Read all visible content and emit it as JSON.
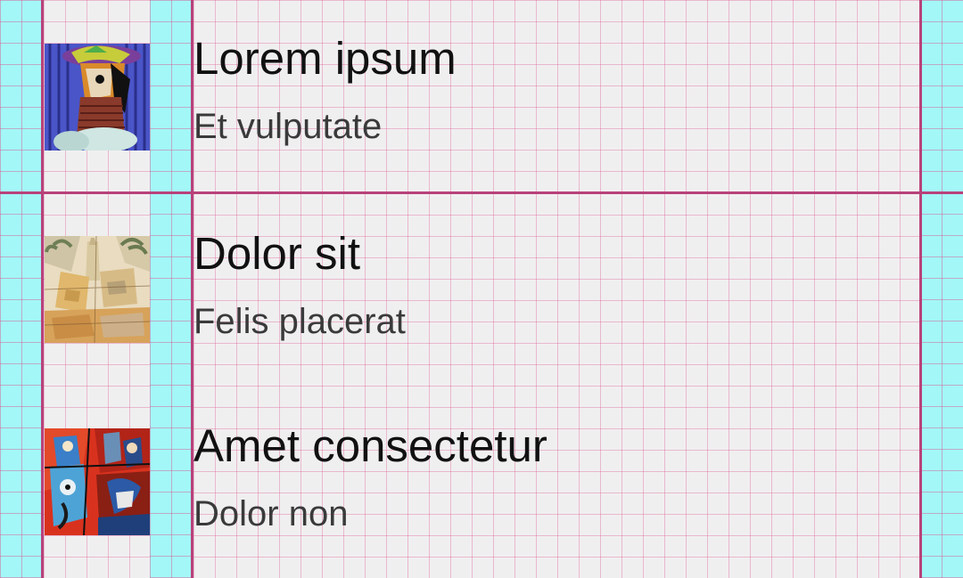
{
  "list": {
    "items": [
      {
        "title": "Lorem ipsum",
        "subtitle": "Et vulputate",
        "thumbnail": "cubist-portrait-woman-hat"
      },
      {
        "title": "Dolor sit",
        "subtitle": "Felis placerat",
        "thumbnail": "cubist-landscape-palm-trees"
      },
      {
        "title": "Amet consectetur",
        "subtitle": "Dolor non",
        "thumbnail": "cubist-figures-red-blue"
      }
    ]
  },
  "colors": {
    "overlay_background": "#a3f7f7",
    "row_background": "#f0eff0",
    "grid_line": "#dc508c",
    "guide_line": "#b8427a",
    "title_text": "#111111",
    "subtitle_text": "#3a3a3a"
  }
}
